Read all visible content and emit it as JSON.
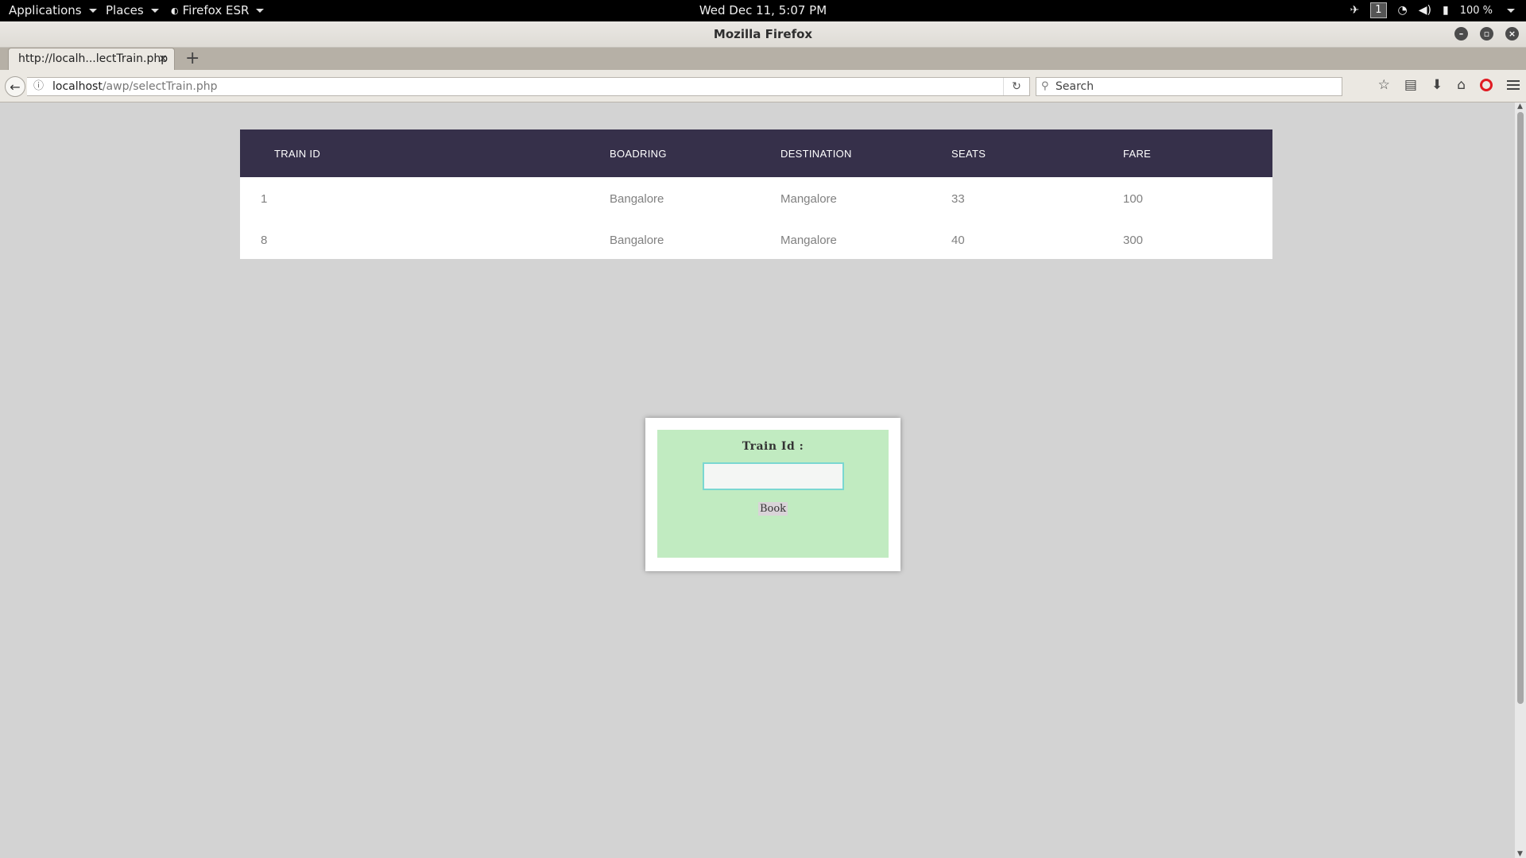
{
  "topbar": {
    "applications": "Applications",
    "places": "Places",
    "firefox": "Firefox ESR",
    "clock": "Wed Dec 11,  5:07 PM",
    "workspace": "1",
    "battery": "100 %"
  },
  "window": {
    "title": "Mozilla Firefox"
  },
  "tab": {
    "title": "http://localh...lectTrain.php",
    "close": "×",
    "new": "+"
  },
  "navbar": {
    "url_host": "localhost",
    "url_path": "/awp/selectTrain.php",
    "search_placeholder": "Search"
  },
  "table": {
    "headers": [
      "TRAIN ID",
      "BOADRING",
      "DESTINATION",
      "SEATS",
      "FARE"
    ],
    "rows": [
      [
        "1",
        "Bangalore",
        "Mangalore",
        "33",
        "100"
      ],
      [
        "8",
        "Bangalore",
        "Mangalore",
        "40",
        "300"
      ]
    ]
  },
  "booking": {
    "label": "Train Id :",
    "input_value": "",
    "button": "Book"
  },
  "colors": {
    "table_header": "#36304a",
    "form_bg": "#c1ebc1",
    "page_bg": "#d3d3d3"
  }
}
